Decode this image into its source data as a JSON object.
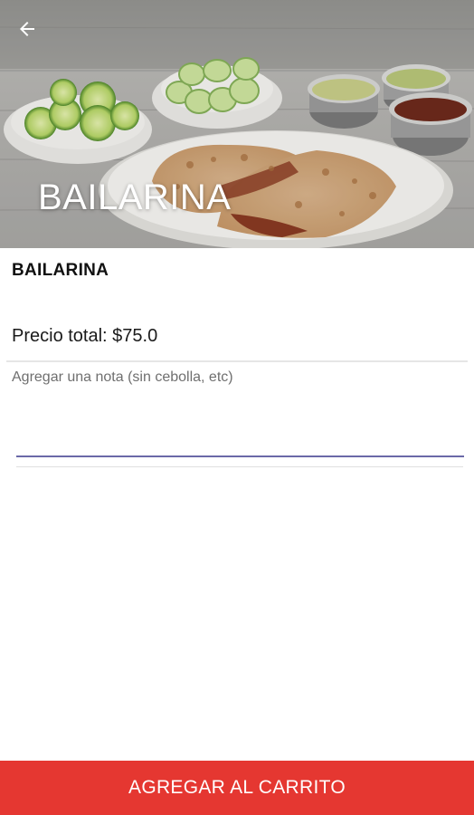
{
  "header": {
    "back_icon": "arrow-left-icon",
    "hero_title": "BAILARINA"
  },
  "product": {
    "name": "BAILARINA",
    "price_text": "Precio total: $75.0"
  },
  "note": {
    "placeholder": "Agregar una nota (sin cebolla, etc)",
    "value": ""
  },
  "footer": {
    "add_to_cart_label": "AGREGAR AL CARRITO"
  },
  "colors": {
    "accent": "#e53731",
    "input_underline": "#6b69a8"
  }
}
